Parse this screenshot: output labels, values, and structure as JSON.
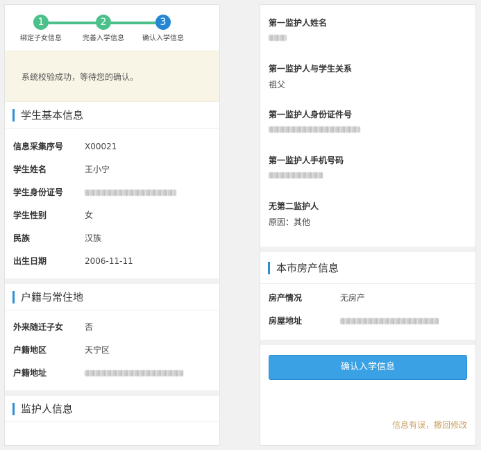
{
  "steps": {
    "items": [
      {
        "num": "1",
        "label": "绑定子女信息",
        "color": "#4cc08a"
      },
      {
        "num": "2",
        "label": "完善入学信息",
        "color": "#4cc08a"
      },
      {
        "num": "3",
        "label": "确认入学信息",
        "color": "#2487d6"
      }
    ],
    "line_color": "#4cc08a"
  },
  "notice": "系统校验成功，等待您的确认。",
  "student": {
    "title": "学生基本信息",
    "rows": [
      {
        "label": "信息采集序号",
        "value": "X00021"
      },
      {
        "label": "学生姓名",
        "value": "王小宁"
      },
      {
        "label": "学生身份证号",
        "value": ""
      },
      {
        "label": "学生性别",
        "value": "女"
      },
      {
        "label": "民族",
        "value": "汉族"
      },
      {
        "label": "出生日期",
        "value": "2006-11-11"
      }
    ]
  },
  "household": {
    "title": "户籍与常住地",
    "rows": [
      {
        "label": "外来随迁子女",
        "value": "否"
      },
      {
        "label": "户籍地区",
        "value": "天宁区"
      },
      {
        "label": "户籍地址",
        "value": ""
      }
    ]
  },
  "guardian": {
    "title": "监护人信息",
    "items": [
      {
        "label": "第一监护人姓名",
        "value": ""
      },
      {
        "label": "第一监护人与学生关系",
        "value": "祖父"
      },
      {
        "label": "第一监护人身份证件号",
        "value": ""
      },
      {
        "label": "第一监护人手机号码",
        "value": ""
      },
      {
        "label": "无第二监护人",
        "value": "原因：其他"
      }
    ]
  },
  "property": {
    "title": "本市房产信息",
    "rows": [
      {
        "label": "房产情况",
        "value": "无房产"
      },
      {
        "label": "房屋地址",
        "value": ""
      }
    ]
  },
  "actions": {
    "confirm": "确认入学信息",
    "revoke": "信息有误，撤回修改"
  },
  "colors": {
    "accent": "#2b8fd8",
    "button": "#3aa2e4",
    "link": "#c9a063"
  }
}
